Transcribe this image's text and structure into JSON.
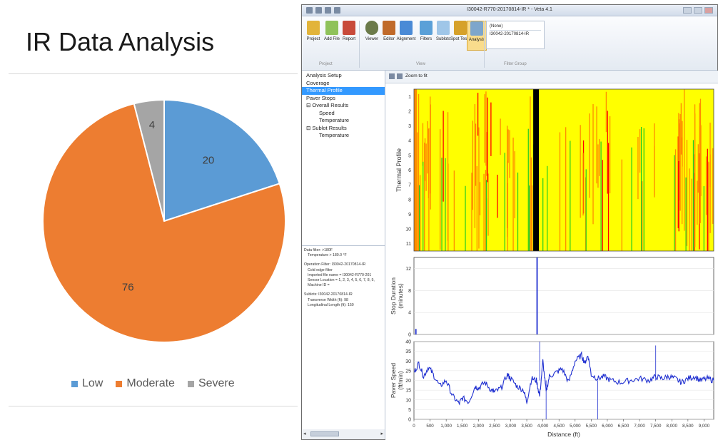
{
  "slide": {
    "title": "IR Data Analysis"
  },
  "chart_data": [
    {
      "type": "pie",
      "title": "",
      "categories": [
        "Low",
        "Moderate",
        "Severe"
      ],
      "values": [
        20,
        76,
        4
      ],
      "colors": [
        "#5b9bd5",
        "#ed7d31",
        "#a5a5a5"
      ],
      "data_labels": [
        "20",
        "76",
        "4"
      ],
      "legend_position": "bottom"
    },
    {
      "type": "heatmap",
      "ylabel": "Thermal Profile",
      "y_ticks": [
        "1",
        "2",
        "3",
        "4",
        "5",
        "6",
        "7",
        "8",
        "9",
        "10",
        "11"
      ],
      "colors": {
        "normal": "#ffff00",
        "moderate": "#ff8c00",
        "severe": "#ff0000",
        "cold": "#22cc22",
        "stop": "#000000"
      }
    },
    {
      "type": "bar",
      "ylabel": "Stop Duration (minutes)",
      "y_ticks": [
        "0",
        "4",
        "8",
        "12"
      ],
      "ylim": [
        0,
        14
      ],
      "x": [
        40,
        3800
      ],
      "values": [
        1,
        14
      ]
    },
    {
      "type": "line",
      "ylabel": "Paver Speed (ft/min)",
      "xlabel": "Distance (ft)",
      "y_ticks": [
        "0",
        "5",
        "10",
        "15",
        "20",
        "25",
        "30",
        "35",
        "40"
      ],
      "x_ticks": [
        "0",
        "500",
        "1,000",
        "1,500",
        "2,000",
        "2,500",
        "3,000",
        "3,500",
        "4,000",
        "4,500",
        "5,000",
        "5,500",
        "6,000",
        "6,500",
        "7,000",
        "7,500",
        "8,000",
        "8,500",
        "9,000"
      ],
      "xlim": [
        0,
        9300
      ],
      "ylim": [
        0,
        40
      ],
      "series": [
        {
          "x": [
            0,
            150,
            300,
            450,
            600,
            800,
            1000,
            1200,
            1400,
            1500,
            1700,
            1900,
            2000,
            2200,
            2400,
            2500,
            2700,
            2900,
            3000,
            3200,
            3400,
            3500,
            3650,
            3800,
            3900,
            4000,
            4100,
            4200,
            4400,
            4600,
            4800,
            5000,
            5200,
            5300,
            5400,
            5500,
            5700,
            5900,
            6100,
            6400,
            6700,
            7000,
            7300,
            7500,
            7700,
            7900,
            8100,
            8300,
            8500,
            8700,
            8900,
            9100,
            9300
          ],
          "values": [
            24,
            29,
            22,
            27,
            23,
            17,
            20,
            12,
            8,
            11,
            9,
            17,
            16,
            19,
            15,
            14,
            16,
            23,
            21,
            17,
            15,
            9,
            21,
            20,
            12,
            30,
            14,
            22,
            24,
            26,
            19,
            30,
            33,
            29,
            33,
            23,
            21,
            22,
            20,
            19,
            20,
            21,
            20,
            22,
            21,
            22,
            21,
            19,
            21,
            22,
            20,
            21,
            20
          ]
        }
      ]
    }
  ],
  "app": {
    "window_title": "I30042-R770-20170814-IR * - Veta 4.1",
    "ribbon": {
      "buttons": [
        "Project",
        "Add File",
        "Report",
        "Viewer",
        "Editor",
        "Alignment",
        "Filters",
        "Sublots",
        "Spot Tests",
        "Analysis"
      ],
      "groups": [
        "Project",
        "View",
        "Filter Group"
      ],
      "filter_items": [
        "(None)",
        "I30042-20170814-IR"
      ]
    },
    "nav": [
      {
        "label": "Analysis Setup",
        "level": 1
      },
      {
        "label": "Coverage",
        "level": 1
      },
      {
        "label": "Thermal Profile",
        "level": 1,
        "selected": true
      },
      {
        "label": "Paver Stops",
        "level": 1
      },
      {
        "label": "⊟ Overall Results",
        "level": 1
      },
      {
        "label": "Speed",
        "level": 2
      },
      {
        "label": "Temperature",
        "level": 2
      },
      {
        "label": "⊟ Sublot Results",
        "level": 1
      },
      {
        "label": "Temperature",
        "level": 2
      }
    ],
    "info": [
      {
        "text": "Data filter: >180F",
        "indent": false
      },
      {
        "text": "Temperature > 180.0 °F",
        "indent": true
      },
      {
        "text": "",
        "gap": true
      },
      {
        "text": "Operation Filter: I30042-20170814-IR",
        "indent": false
      },
      {
        "text": "Cold edge filter",
        "indent": true
      },
      {
        "text": "Imported file name = I30042-R770-201",
        "indent": true
      },
      {
        "text": "Sensor Location = 1, 2, 3, 4, 5, 6, 7, 8, 9,",
        "indent": true
      },
      {
        "text": "Machine ID =",
        "indent": true
      },
      {
        "text": "",
        "gap": true
      },
      {
        "text": "Sublots: I30042-20170814-IR",
        "indent": false
      },
      {
        "text": "Transverse Width (ft): 98",
        "indent": true
      },
      {
        "text": "Longitudinal Length (ft): 150",
        "indent": true
      }
    ],
    "toolbar": {
      "zoom_label": "Zoom to fit"
    }
  }
}
